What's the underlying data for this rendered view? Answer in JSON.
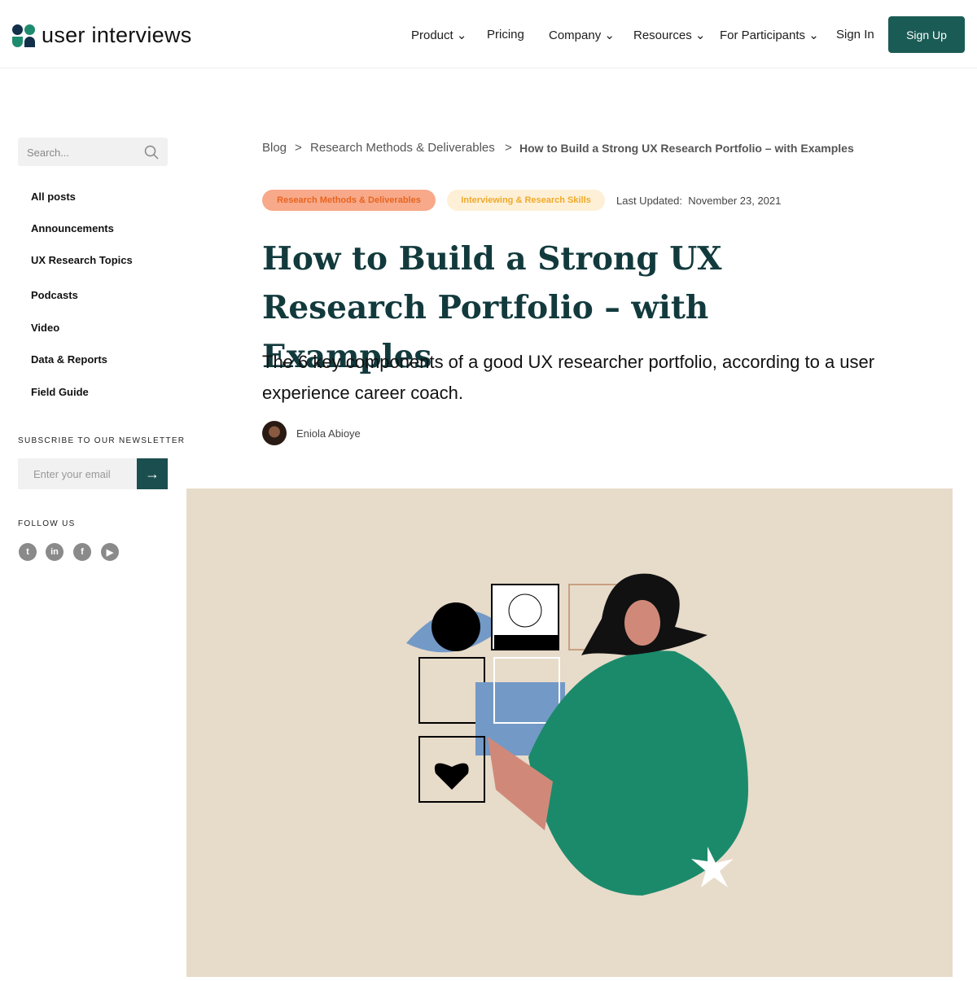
{
  "header": {
    "logo": "user interviews",
    "nav": [
      {
        "label": "Product",
        "dropdown": true
      },
      {
        "label": "Pricing",
        "dropdown": false
      },
      {
        "label": "Company",
        "dropdown": true
      },
      {
        "label": "Resources",
        "dropdown": true
      },
      {
        "label": "For Participants",
        "dropdown": true
      },
      {
        "label": "Sign In",
        "dropdown": false
      }
    ],
    "signup": "Sign Up"
  },
  "sidebar": {
    "search_placeholder": "Search...",
    "items": [
      "All posts",
      "Announcements",
      "UX Research Topics",
      "Podcasts",
      "Video",
      "Data & Reports",
      "Field Guide"
    ],
    "newsletter_heading": "SUBSCRIBE TO OUR NEWSLETTER",
    "email_placeholder": "Enter your email",
    "follow_heading": "FOLLOW US",
    "social": [
      "twitter",
      "linkedin",
      "facebook",
      "youtube"
    ]
  },
  "article": {
    "breadcrumb": [
      "Blog",
      "Research Methods & Deliverables",
      "How to Build a Strong UX Research Portfolio – with Examples"
    ],
    "separator": ">",
    "tags": [
      "Research Methods & Deliverables",
      "Interviewing & Research Skills"
    ],
    "updated_label": "Last Updated:",
    "updated_date": "November 23, 2021",
    "title": "How to Build a Strong UX Research Portfolio – with Examples",
    "subtitle": "The 6 key components of a good UX researcher portfolio, according to a user experience career coach.",
    "author": "Eniola Abioye"
  },
  "colors": {
    "brand": "#1b5b55",
    "tag1_bg": "#f7a98a",
    "tag1_text": "#e8641f",
    "tag2_bg": "#fdf0d6",
    "tag2_text": "#f0a92a",
    "hero_bg": "#e7dbca"
  }
}
